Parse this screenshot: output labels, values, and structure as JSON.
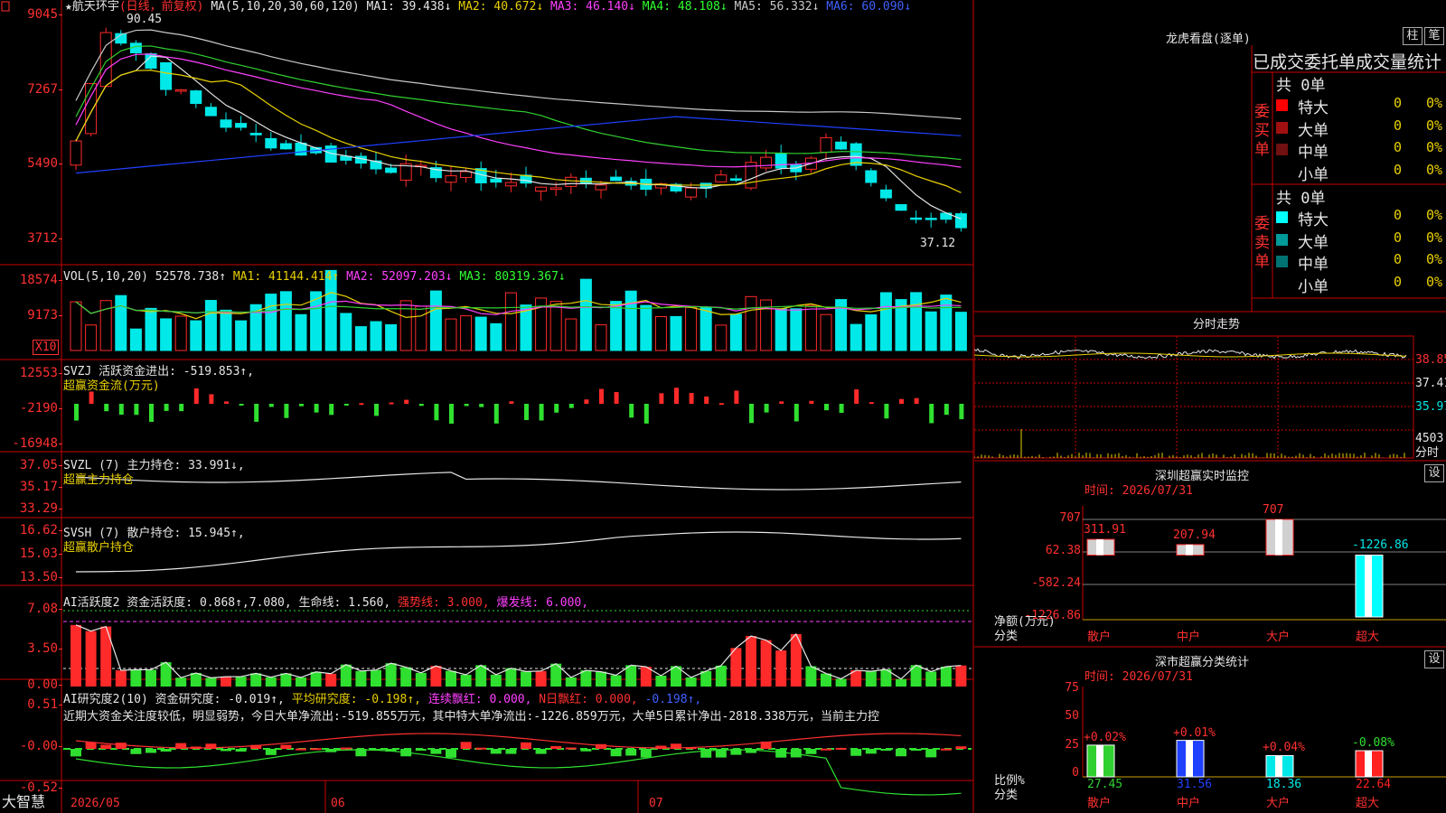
{
  "stock": {
    "name": "航天环宇",
    "period": "(日线，前复权)",
    "ma_params": "MA(5,10,20,30,60,120)",
    "ma1": "MA1: 39.438↓",
    "ma2": "MA2: 40.672↓",
    "ma3": "MA3: 46.140↓",
    "ma4": "MA4: 48.108↓",
    "ma5": "MA5: 56.332↓",
    "ma6": "MA6: 60.090↓",
    "price_high": "90.45",
    "price_low": "37.12",
    "price_ticks": [
      "9045",
      "7267",
      "5490",
      "3712"
    ]
  },
  "vol": {
    "label": "VOL(5,10,20)",
    "value": "52578.738↑",
    "ma1": "MA1: 41144.414↑",
    "ma2": "MA2: 52097.203↓",
    "ma3": "MA3: 80319.367↓",
    "ticks": [
      "18574",
      "9173"
    ],
    "unit": "X10"
  },
  "svzj": {
    "label": "SVZJ  活跃资金进出: -519.853↑,",
    "sub": "超赢资金流(万元)",
    "ticks": [
      "12553",
      "-2190",
      "-16948"
    ]
  },
  "svzl": {
    "label": "SVZL (7) 主力持仓: 33.991↓,",
    "sub": "超赢主力持仓",
    "ticks": [
      "37.05",
      "35.17",
      "33.29"
    ]
  },
  "svsh": {
    "label": "SVSH (7) 散户持仓: 15.945↑,",
    "sub": "超赢散户持仓",
    "ticks": [
      "16.62",
      "15.03",
      "13.50"
    ]
  },
  "ai_active": {
    "label": "AI活跃度2 资金活跃度: 0.868↑,7.080,",
    "life": "生命线: 1.560,",
    "strong": "强势线: 3.000,",
    "burst": "爆发线: 6.000,",
    "ticks": [
      "7.08",
      "3.50",
      "0.00"
    ]
  },
  "ai_research": {
    "label": "AI研究度2(10) 资金研究度: -0.019↑,",
    "avg": "平均研究度: -0.198↑,",
    "cont": "连续飘红: 0.000,",
    "nday": "N日飘红: 0.000,",
    "tail": "-0.198↑,",
    "text": "近期大资金关注度较低，明显弱势，今日大单净流出:-519.855万元，其中特大单净流出:-1226.859万元，大单5日累计净出-2818.338万元，当前主力控",
    "ticks": [
      "0.51",
      "-0.00",
      "-0.52"
    ]
  },
  "xaxis": {
    "brand": "大智慧",
    "labels": [
      "2026/05",
      "06",
      "07"
    ]
  },
  "dragon": {
    "title": "龙虎看盘(逐单)",
    "btn1": "柱",
    "btn2": "笔",
    "tabs": "已成交委托单成交量统计",
    "buy_label": "委买单",
    "sell_label": "委卖单",
    "buy_total": "共 0单",
    "sell_total": "共 0单",
    "buy_rows": [
      {
        "name": "特大",
        "n": "0",
        "p": "0%",
        "color": "#ff0000"
      },
      {
        "name": "大单",
        "n": "0",
        "p": "0%",
        "color": "#a01010"
      },
      {
        "name": "中单",
        "n": "0",
        "p": "0%",
        "color": "#701010"
      },
      {
        "name": "小单",
        "n": "0",
        "p": "0%",
        "color": "#000000"
      }
    ],
    "sell_rows": [
      {
        "name": "特大",
        "n": "0",
        "p": "0%",
        "color": "#00ffff"
      },
      {
        "name": "大单",
        "n": "0",
        "p": "0%",
        "color": "#009a9a"
      },
      {
        "name": "中单",
        "n": "0",
        "p": "0%",
        "color": "#007272"
      },
      {
        "name": "小单",
        "n": "0",
        "p": "0%",
        "color": "#000000"
      }
    ]
  },
  "intraday": {
    "title": "分时走势",
    "ticks": [
      "38.85",
      "37.41",
      "35.97"
    ],
    "vol_tick": "4503",
    "vol_label": "分时"
  },
  "sz_monitor": {
    "title": "深圳超赢实时监控",
    "set": "设",
    "time": "时间: 2026/07/31",
    "ticks": [
      "707",
      "62.38",
      "-582.24",
      "-1226.86"
    ],
    "ylabel1": "净额(万元)",
    "ylabel2": "分类",
    "bars": [
      {
        "cat": "散户",
        "value": 311.91,
        "label": "311.91"
      },
      {
        "cat": "中户",
        "value": 207.94,
        "label": "207.94"
      },
      {
        "cat": "大户",
        "value": 707,
        "label": "707"
      },
      {
        "cat": "超大",
        "value": -1226.86,
        "label": "-1226.86"
      }
    ]
  },
  "sz_class": {
    "title": "深市超赢分类统计",
    "set": "设",
    "time": "时间: 2026/07/31",
    "ticks": [
      "75",
      "50",
      "25",
      "0"
    ],
    "ylabel1": "比例%",
    "ylabel2": "分类",
    "bars": [
      {
        "cat": "散户",
        "value": 27.45,
        "label": "27.45",
        "chg": "+0.02%",
        "color": "#30d030"
      },
      {
        "cat": "中户",
        "value": 31.56,
        "label": "31.56",
        "chg": "+0.01%",
        "color": "#2040ff"
      },
      {
        "cat": "大户",
        "value": 18.36,
        "label": "18.36",
        "chg": "+0.04%",
        "color": "#00e8e8"
      },
      {
        "cat": "超大",
        "value": 22.64,
        "label": "22.64",
        "chg": "-0.08%",
        "color": "#ff2020"
      }
    ]
  },
  "colors": {
    "up": "#ff2a2a",
    "down": "#00e8e8",
    "grid": "#c80000"
  }
}
